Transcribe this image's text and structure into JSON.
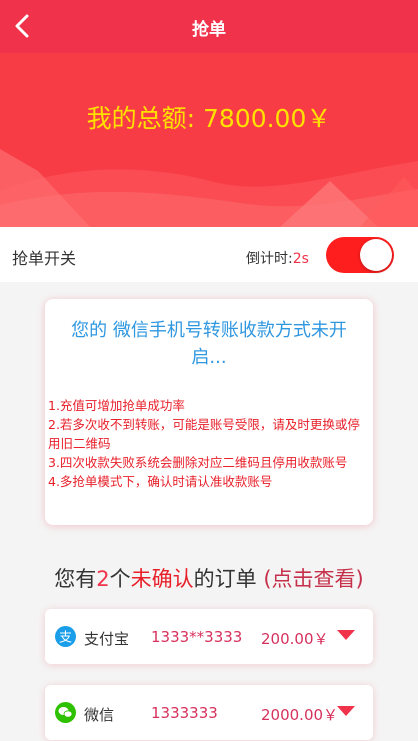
{
  "header": {
    "title": "抢单",
    "back_icon": "chevron-left-icon"
  },
  "banner": {
    "total_text": "我的总额: 7800.00￥"
  },
  "grab_switch": {
    "label": "抢单开关",
    "countdown_label": "倒计时:",
    "countdown_value": "2s",
    "state": "on"
  },
  "notice": {
    "title": "您的 微信手机号转账收款方式未开启...",
    "rules": [
      "1.充值可增加抢单成功率",
      "2.若多次收不到转账，可能是账号受限，请及时更换或停用旧二维码",
      "3.四次收款失败系统会删除对应二维码且停用收款账号",
      "4.多抢单模式下，确认时请认准收款账号"
    ]
  },
  "pending": {
    "prefix": "您有",
    "count": "2",
    "unit": "个",
    "unconfirmed": "未确认",
    "suffix": "的订单",
    "link": "(点击查看)"
  },
  "orders": [
    {
      "method": "支付宝",
      "account": "1333**3333",
      "amount": "200.00￥",
      "icon": "alipay-icon",
      "icon_color": "#1a9ee9"
    },
    {
      "method": "微信",
      "account": "1333333",
      "amount": "2000.00￥",
      "icon": "wechat-icon",
      "icon_color": "#2dc100"
    }
  ]
}
